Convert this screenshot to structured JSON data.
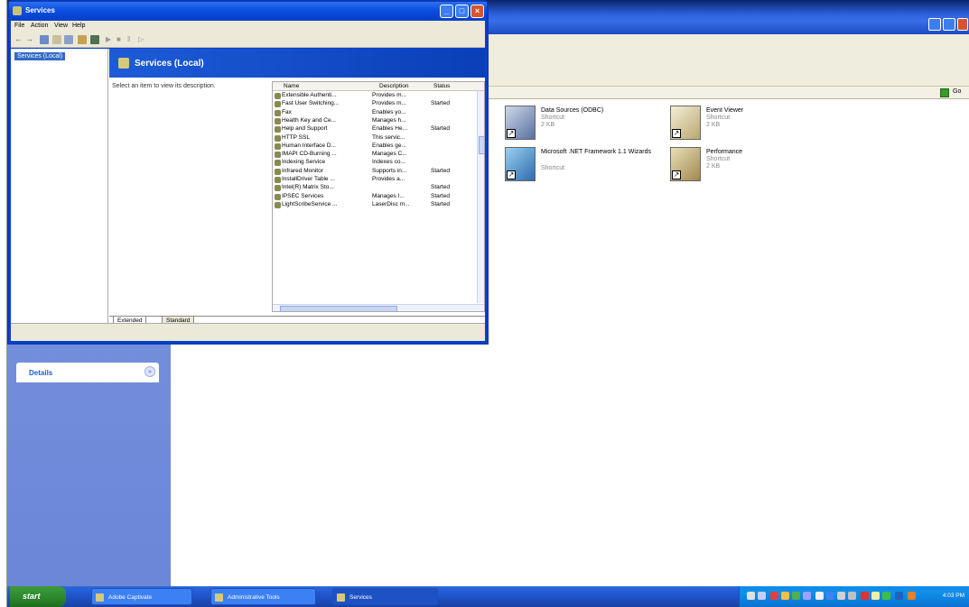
{
  "background_window": {
    "go_label": "Go",
    "details_label": "Details",
    "tiles": [
      {
        "name": "Data Sources (ODBC)",
        "line1": "Shortcut",
        "line2": "2 KB"
      },
      {
        "name": "Event Viewer",
        "line1": "Shortcut",
        "line2": "2 KB"
      },
      {
        "name": "Microsoft .NET Framework 1.1 Wizards",
        "line1": "Shortcut",
        "line2": ""
      },
      {
        "name": "Performance",
        "line1": "Shortcut",
        "line2": "2 KB"
      }
    ]
  },
  "services_window": {
    "title": "Services",
    "menu": [
      "File",
      "Action",
      "View",
      "Help"
    ],
    "tree_item": "Services (Local)",
    "header_title": "Services (Local)",
    "description_hint": "Select an item to view its description.",
    "columns": [
      "Name",
      "Description",
      "Status"
    ],
    "rows": [
      {
        "name": "Extensible Authenti...",
        "desc": "Provides m...",
        "status": ""
      },
      {
        "name": "Fast User Switching...",
        "desc": "Provides m...",
        "status": "Started"
      },
      {
        "name": "Fax",
        "desc": "Enables yo...",
        "status": ""
      },
      {
        "name": "Health Key and Ce...",
        "desc": "Manages h...",
        "status": ""
      },
      {
        "name": "Help and Support",
        "desc": "Enables He...",
        "status": "Started"
      },
      {
        "name": "HTTP SSL",
        "desc": "This servic...",
        "status": ""
      },
      {
        "name": "Human Interface D...",
        "desc": "Enables ge...",
        "status": ""
      },
      {
        "name": "IMAPI CD-Burning ...",
        "desc": "Manages C...",
        "status": ""
      },
      {
        "name": "Indexing Service",
        "desc": "Indexes co...",
        "status": ""
      },
      {
        "name": "Infrared Monitor",
        "desc": "Supports in...",
        "status": "Started"
      },
      {
        "name": "InstallDriver Table ...",
        "desc": "Provides a...",
        "status": ""
      },
      {
        "name": "Intel(R) Matrix Sto...",
        "desc": "",
        "status": "Started"
      },
      {
        "name": "IPSEC Services",
        "desc": "Manages I...",
        "status": "Started"
      },
      {
        "name": "LightScribeService ...",
        "desc": "LaserDisc m...",
        "status": "Started"
      }
    ],
    "tabs": [
      "Extended",
      "Standard"
    ]
  },
  "taskbar": {
    "start_label": "start",
    "tasks": [
      "Adobe Captivate",
      "Administrative Tools",
      "Services"
    ],
    "clock": "4:03 PM"
  }
}
